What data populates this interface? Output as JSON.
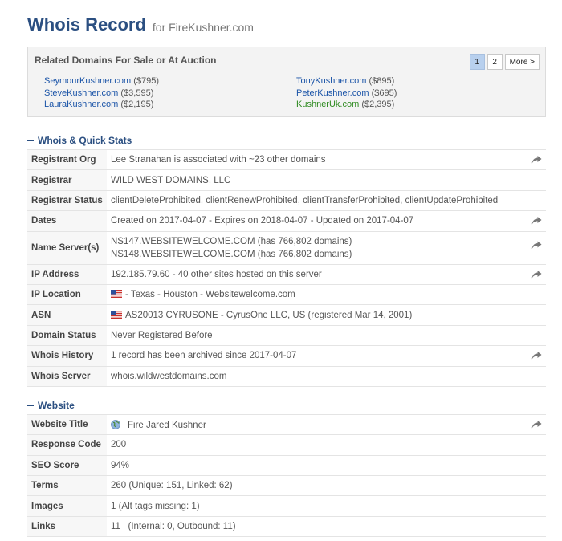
{
  "header": {
    "title": "Whois Record",
    "subtitle": "for FireKushner.com"
  },
  "related": {
    "title": "Related Domains For Sale or At Auction",
    "pager": [
      "1",
      "2",
      "More >"
    ],
    "left": [
      {
        "domain": "SeymourKushner.com",
        "price": "($795)"
      },
      {
        "domain": "SteveKushner.com",
        "price": "($3,595)"
      },
      {
        "domain": "LauraKushner.com",
        "price": "($2,195)"
      }
    ],
    "right": [
      {
        "domain": "TonyKushner.com",
        "price": "($895)"
      },
      {
        "domain": "PeterKushner.com",
        "price": "($695)"
      },
      {
        "domain": "KushnerUk.com",
        "price": "($2,395)"
      }
    ],
    "colors": {
      "blue_link": "#1c55a8",
      "green_link": "#2d8a1f"
    }
  },
  "whois": {
    "heading": "Whois & Quick Stats",
    "registrant_org": {
      "label": "Registrant Org",
      "value": "Lee Stranahan is associated with ~23 other domains"
    },
    "registrar": {
      "label": "Registrar",
      "value": "WILD WEST DOMAINS, LLC"
    },
    "registrar_status": {
      "label": "Registrar Status",
      "value": "clientDeleteProhibited, clientRenewProhibited, clientTransferProhibited, clientUpdateProhibited"
    },
    "dates": {
      "label": "Dates",
      "value": "Created on 2017-04-07 - Expires on 2018-04-07 - Updated on 2017-04-07"
    },
    "name_servers": {
      "label": "Name Server(s)",
      "ns1": "NS147.WEBSITEWELCOME.COM (has 766,802 domains)",
      "ns2": "NS148.WEBSITEWELCOME.COM (has 766,802 domains)"
    },
    "ip_address": {
      "label": "IP Address",
      "value": "192.185.79.60 - 40 other sites hosted on this server"
    },
    "ip_location": {
      "label": "IP Location",
      "value": "- Texas - Houston - Websitewelcome.com"
    },
    "asn": {
      "label": "ASN",
      "value": "AS20013 CYRUSONE - CyrusOne LLC, US (registered Mar 14, 2001)"
    },
    "domain_status": {
      "label": "Domain Status",
      "value": "Never Registered Before"
    },
    "whois_history": {
      "label": "Whois History",
      "value": "1 record has been archived since 2017-04-07"
    },
    "whois_server": {
      "label": "Whois Server",
      "value": "whois.wildwestdomains.com"
    }
  },
  "website": {
    "heading": "Website",
    "title": {
      "label": "Website Title",
      "value": "Fire Jared Kushner"
    },
    "response_code": {
      "label": "Response Code",
      "value": "200"
    },
    "seo_score": {
      "label": "SEO Score",
      "value": "94%"
    },
    "terms": {
      "label": "Terms",
      "value": "260 (Unique: 151, Linked: 62)"
    },
    "images": {
      "label": "Images",
      "value": "1 (Alt tags missing: 1)"
    },
    "links": {
      "label": "Links",
      "value": "11   (Internal: 0, Outbound: 11)"
    }
  },
  "icons": {
    "share": "share-arrow-icon",
    "flag": "us-flag-icon",
    "favicon": "globe-icon"
  },
  "colors": {
    "heading_blue": "#2b4f81",
    "pager_active": "#b8d0ee",
    "label_bg": "#f7f7f7"
  }
}
